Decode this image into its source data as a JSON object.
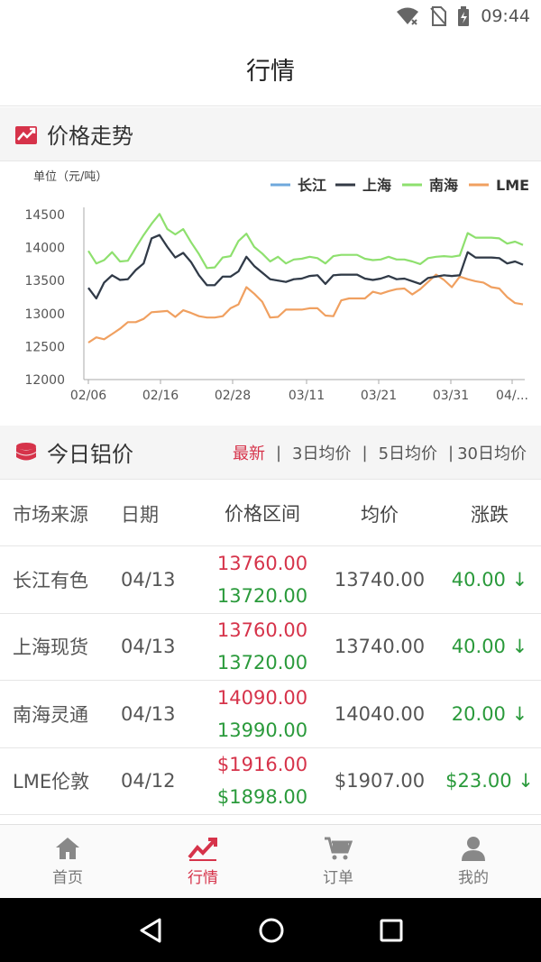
{
  "status": {
    "time": "09:44"
  },
  "header": {
    "title": "行情"
  },
  "trend": {
    "title": "价格走势",
    "unit_label": "单位（元/吨）"
  },
  "chart_data": {
    "type": "line",
    "ylabel": "单位（元/吨）",
    "ylim": [
      12000,
      14500
    ],
    "yticks": [
      12000,
      12500,
      13000,
      13500,
      14000,
      14500
    ],
    "xtick_labels": [
      "02/06",
      "02/16",
      "02/28",
      "03/11",
      "03/21",
      "03/31",
      "04/..."
    ],
    "grid": false,
    "legend": "top-right",
    "series": [
      {
        "name": "长江",
        "color": "#6fa8dc",
        "values": [
          13390,
          13230,
          13470,
          13580,
          13510,
          13520,
          13660,
          13760,
          14140,
          14190,
          14010,
          13850,
          13920,
          13780,
          13580,
          13430,
          13430,
          13560,
          13560,
          13640,
          13860,
          13720,
          13620,
          13520,
          13500,
          13480,
          13520,
          13530,
          13570,
          13580,
          13450,
          13580,
          13590,
          13590,
          13590,
          13530,
          13510,
          13530,
          13570,
          13520,
          13530,
          13490,
          13450,
          13540,
          13560,
          13580,
          13570,
          13580,
          13930,
          13850,
          13850,
          13850,
          13840,
          13760,
          13790,
          13740
        ]
      },
      {
        "name": "上海",
        "color": "#333a45",
        "values": [
          13390,
          13230,
          13470,
          13580,
          13510,
          13520,
          13660,
          13760,
          14140,
          14190,
          14010,
          13850,
          13920,
          13780,
          13580,
          13430,
          13430,
          13560,
          13560,
          13640,
          13860,
          13720,
          13620,
          13520,
          13500,
          13480,
          13520,
          13530,
          13570,
          13580,
          13450,
          13580,
          13590,
          13590,
          13590,
          13530,
          13510,
          13530,
          13570,
          13520,
          13530,
          13490,
          13450,
          13540,
          13560,
          13580,
          13570,
          13580,
          13930,
          13850,
          13850,
          13850,
          13840,
          13760,
          13790,
          13740
        ]
      },
      {
        "name": "南海",
        "color": "#8ee06e",
        "values": [
          13950,
          13760,
          13810,
          13930,
          13790,
          13800,
          14000,
          14190,
          14360,
          14510,
          14280,
          14200,
          14280,
          14080,
          13900,
          13690,
          13700,
          13850,
          13870,
          14100,
          14210,
          14010,
          13910,
          13790,
          13860,
          13760,
          13820,
          13830,
          13860,
          13840,
          13760,
          13870,
          13890,
          13890,
          13890,
          13830,
          13810,
          13820,
          13860,
          13820,
          13820,
          13790,
          13750,
          13840,
          13860,
          13870,
          13860,
          13880,
          14220,
          14150,
          14150,
          14150,
          14140,
          14060,
          14090,
          14040
        ]
      },
      {
        "name": "LME",
        "color": "#f0a060",
        "values": [
          12560,
          12640,
          12610,
          12690,
          12770,
          12870,
          12870,
          12920,
          13020,
          13030,
          13040,
          12950,
          13050,
          13010,
          12960,
          12940,
          12940,
          12960,
          13080,
          13140,
          13400,
          13300,
          13180,
          12940,
          12950,
          13060,
          13060,
          13060,
          13080,
          13080,
          12970,
          12960,
          13200,
          13230,
          13230,
          13230,
          13330,
          13300,
          13340,
          13370,
          13380,
          13290,
          13370,
          13480,
          13590,
          13510,
          13400,
          13560,
          13520,
          13490,
          13470,
          13400,
          13380,
          13250,
          13160,
          13140
        ]
      }
    ]
  },
  "today": {
    "title": "今日铝价",
    "tabs": [
      "最新",
      "3日均价",
      "5日均价",
      "30日均价"
    ],
    "separators": [
      "|",
      "|",
      "|"
    ]
  },
  "table": {
    "headers": [
      "市场来源",
      "日期",
      "价格区间",
      "均价",
      "涨跌"
    ],
    "rows": [
      {
        "market": "长江有色",
        "date": "04/13",
        "high": "13760.00",
        "low": "13720.00",
        "avg": "13740.00",
        "change": "40.00 ↓"
      },
      {
        "market": "上海现货",
        "date": "04/13",
        "high": "13760.00",
        "low": "13720.00",
        "avg": "13740.00",
        "change": "40.00 ↓"
      },
      {
        "market": "南海灵通",
        "date": "04/13",
        "high": "14090.00",
        "low": "13990.00",
        "avg": "14040.00",
        "change": "20.00 ↓"
      },
      {
        "market": "LME伦敦",
        "date": "04/12",
        "high": "$1916.00",
        "low": "$1898.00",
        "avg": "$1907.00",
        "change": "$23.00 ↓"
      }
    ]
  },
  "nav": [
    {
      "label": "首页",
      "icon": "home-icon"
    },
    {
      "label": "行情",
      "icon": "trend-icon"
    },
    {
      "label": "订单",
      "icon": "cart-icon"
    },
    {
      "label": "我的",
      "icon": "user-icon"
    }
  ],
  "colors": {
    "accent": "#d6334a",
    "down": "#2a9a3b"
  }
}
